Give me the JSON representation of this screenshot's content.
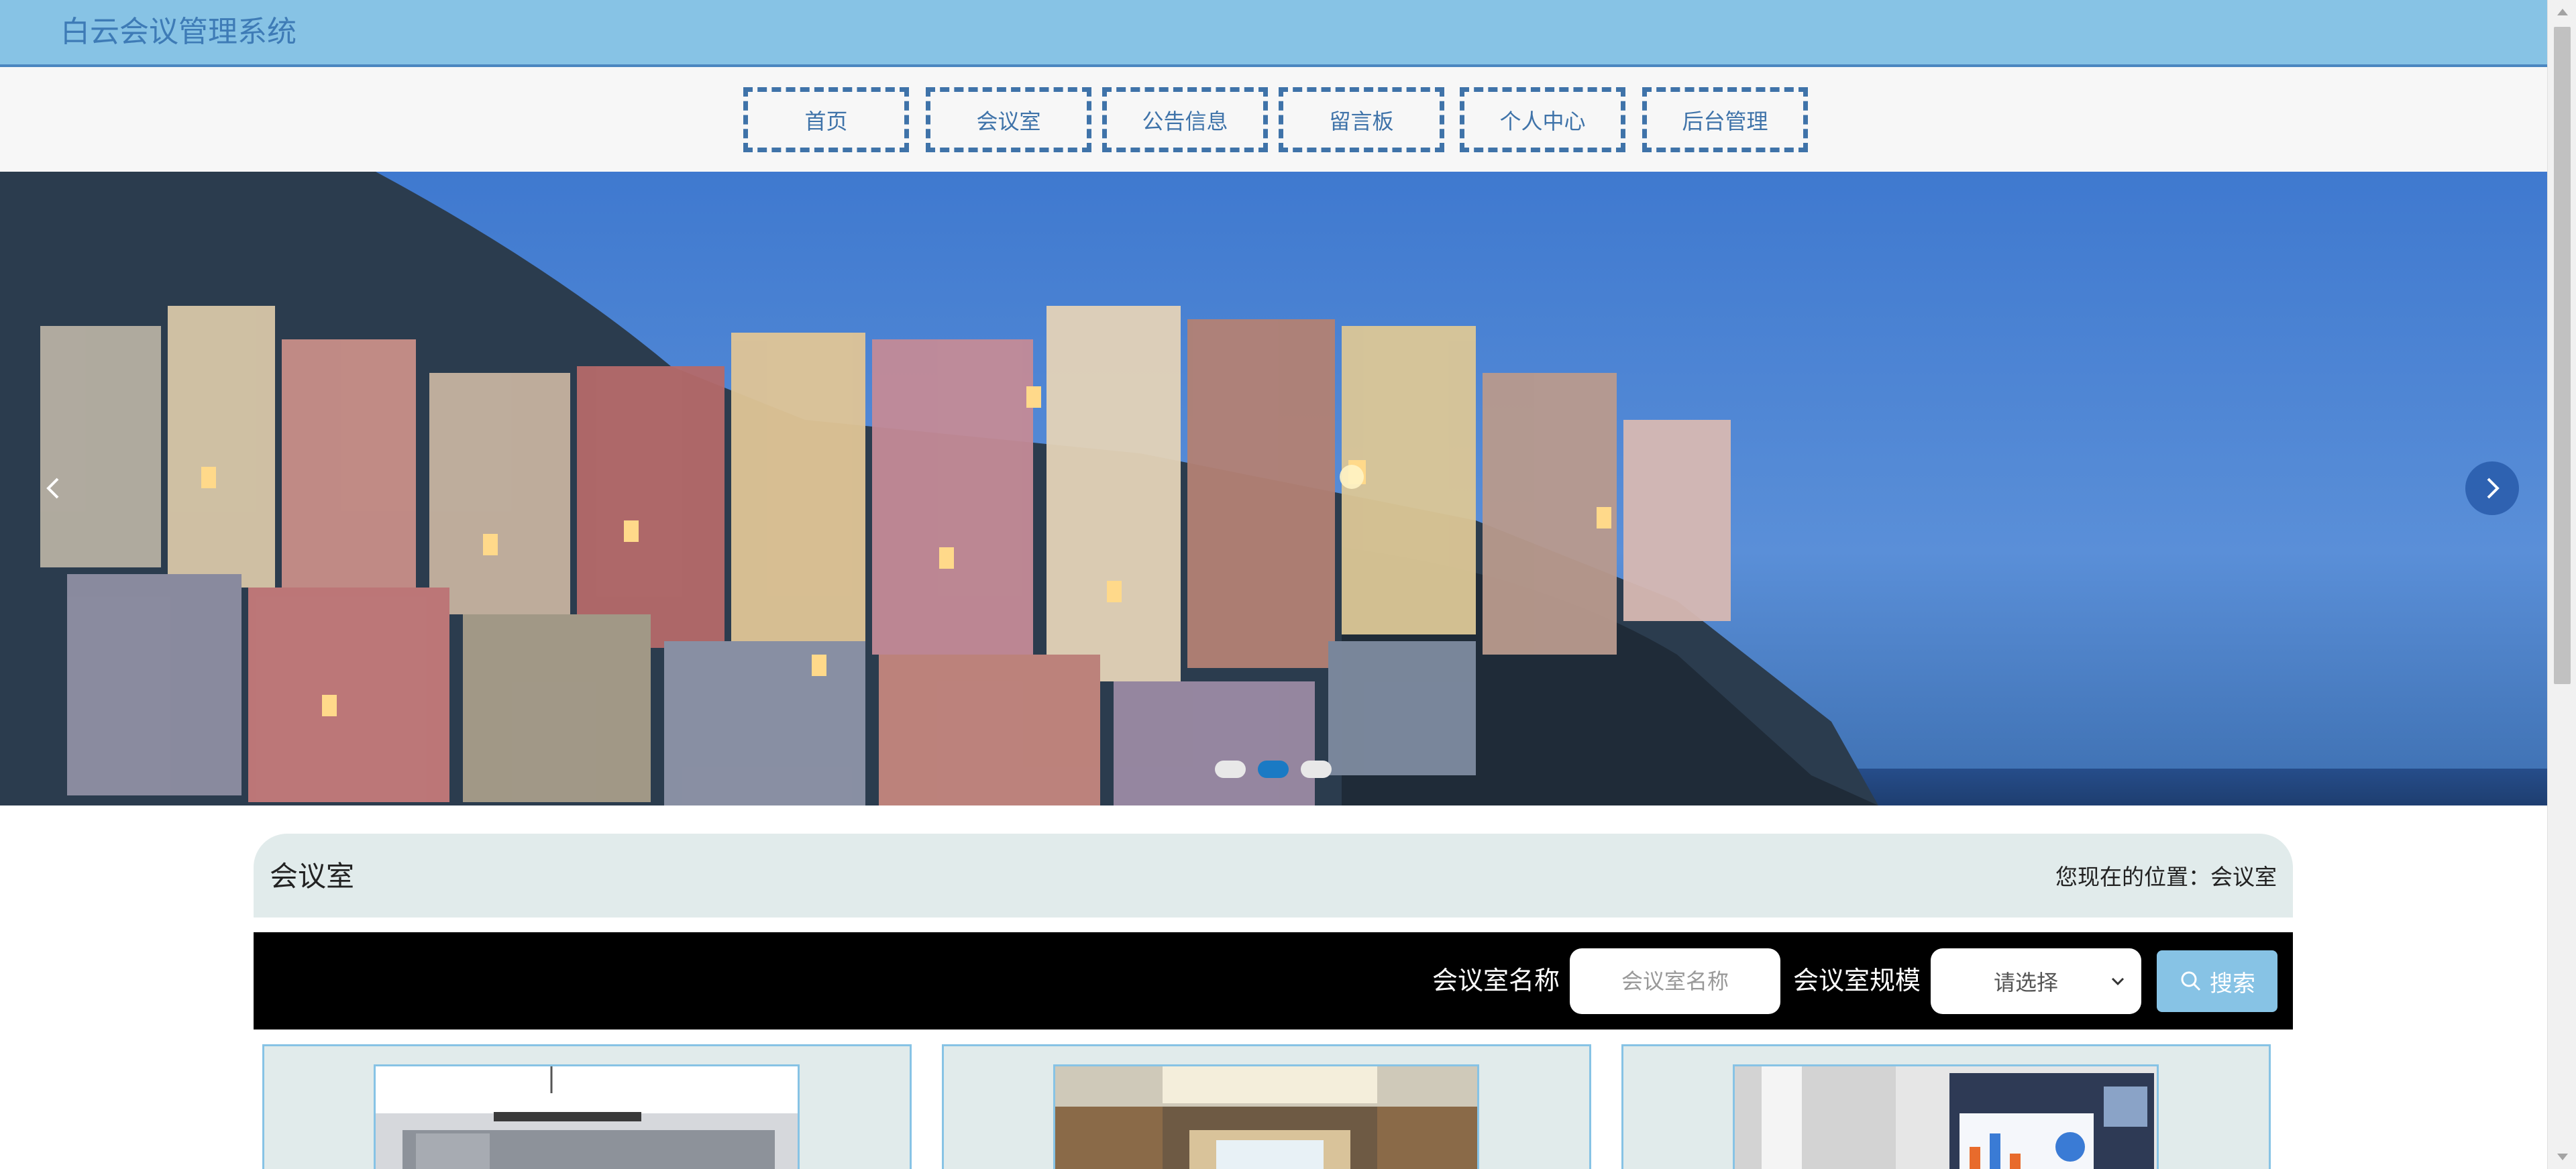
{
  "header": {
    "site_title": "白云会议管理系统"
  },
  "nav": {
    "items": [
      {
        "label": "首页"
      },
      {
        "label": "会议室"
      },
      {
        "label": "公告信息"
      },
      {
        "label": "留言板"
      },
      {
        "label": "个人中心"
      },
      {
        "label": "后台管理"
      }
    ]
  },
  "banner": {
    "slide_count": 3,
    "active_slide": 2,
    "image": "harbor-village-at-dusk"
  },
  "section": {
    "title": "会议室",
    "breadcrumb_prefix": "您现在的位置：",
    "breadcrumb_current": "会议室"
  },
  "search": {
    "name_label": "会议室名称",
    "name_placeholder": "会议室名称",
    "scale_label": "会议室规模",
    "scale_selected": "请选择",
    "button_label": "搜索"
  },
  "cards": [
    {
      "image": "empty-conference-room"
    },
    {
      "image": "wood-panel-meeting-hall"
    },
    {
      "image": "video-conference-room"
    }
  ],
  "colors": {
    "header_bg": "#87c3e5",
    "nav_border": "#3f73a9",
    "section_bg": "#e1ebeb",
    "search_bg": "#000000",
    "active_dot": "#1a7ac4"
  }
}
